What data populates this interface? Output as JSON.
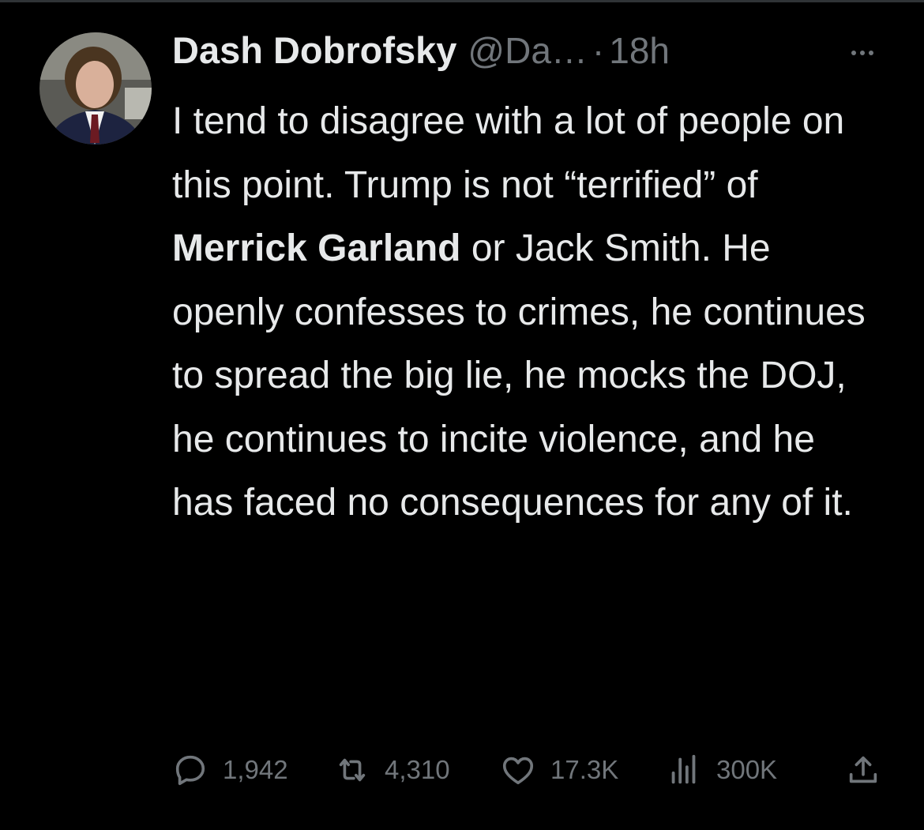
{
  "tweet": {
    "author": {
      "display_name": "Dash Dobrofsky",
      "handle": "@Da…",
      "avatar": "profile-photo"
    },
    "separator": "·",
    "timestamp": "18h",
    "text": {
      "part1": "I tend to disagree with a lot of people on this point. Trump is not “terrified” of ",
      "bold1": "Merrick Garland",
      "part2": " or Jack Smith. He openly confesses to crimes, he continues to spread the big lie, he mocks the DOJ, he continues to incite violence, and he has faced no consequences for any of it."
    },
    "actions": {
      "replies": "1,942",
      "retweets": "4,310",
      "likes": "17.3K",
      "views": "300K"
    },
    "icons": [
      "more-icon",
      "reply-icon",
      "retweet-icon",
      "like-icon",
      "views-icon",
      "share-icon"
    ]
  },
  "colors": {
    "background": "#000000",
    "text": "#e7e9ea",
    "secondary": "#71767b"
  }
}
